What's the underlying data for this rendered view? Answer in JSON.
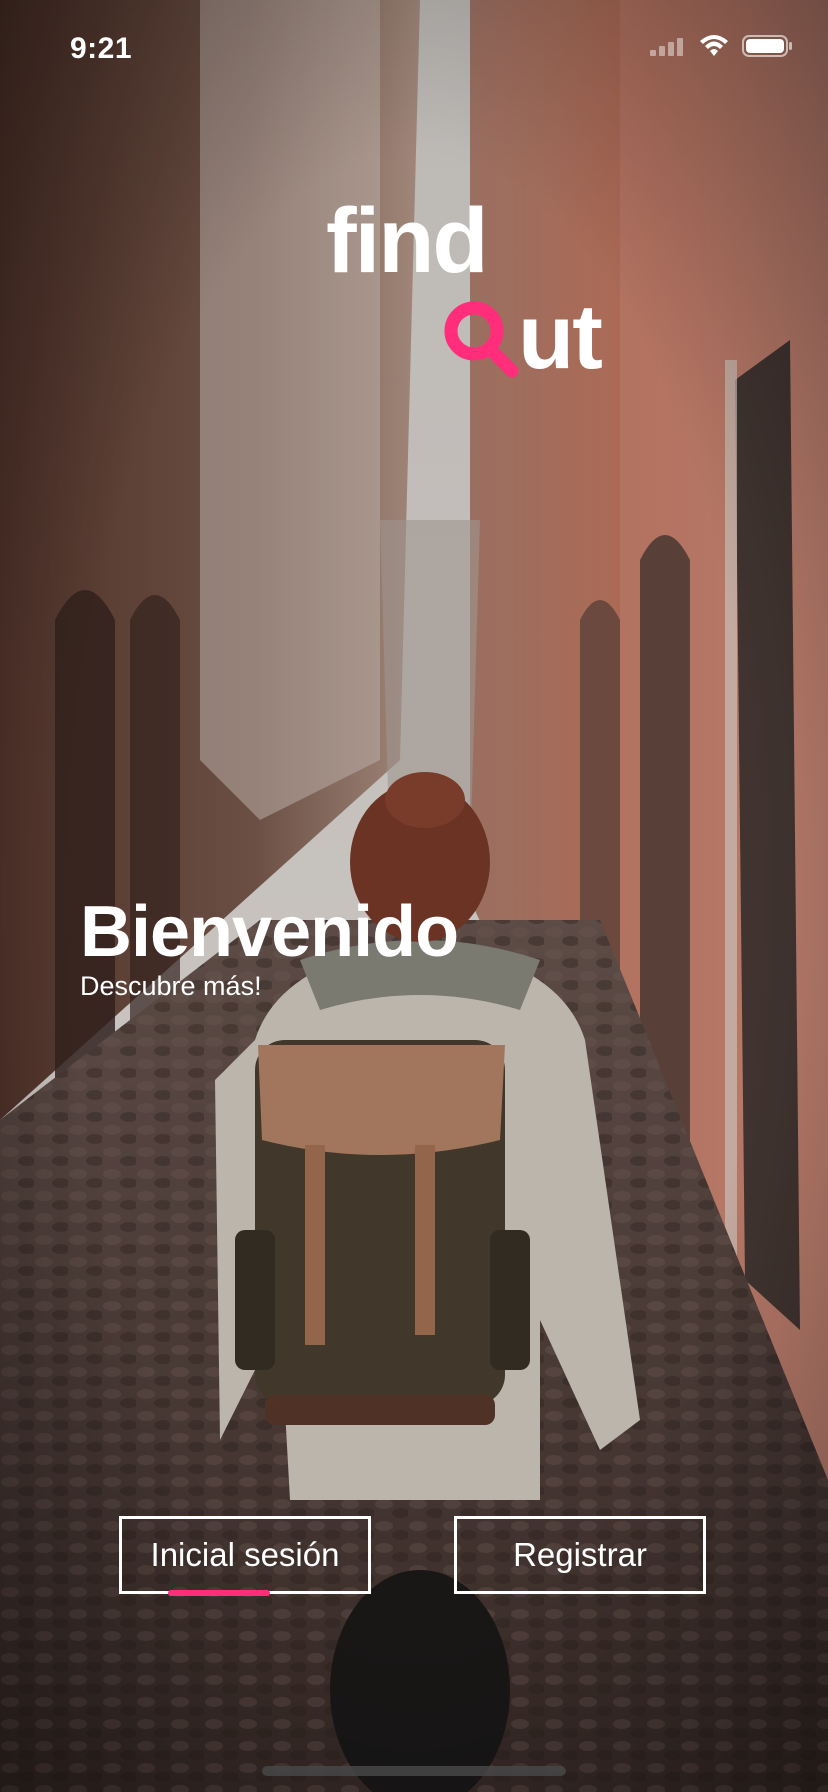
{
  "status_bar": {
    "time": "9:21"
  },
  "logo": {
    "line1": "find",
    "line2_rest": "ut",
    "accent_color": "#ff2d7a"
  },
  "welcome": {
    "title": "Bienvenido",
    "subtitle": "Descubre más!"
  },
  "actions": {
    "login_label": "Inicial sesión",
    "register_label": "Registrar"
  }
}
